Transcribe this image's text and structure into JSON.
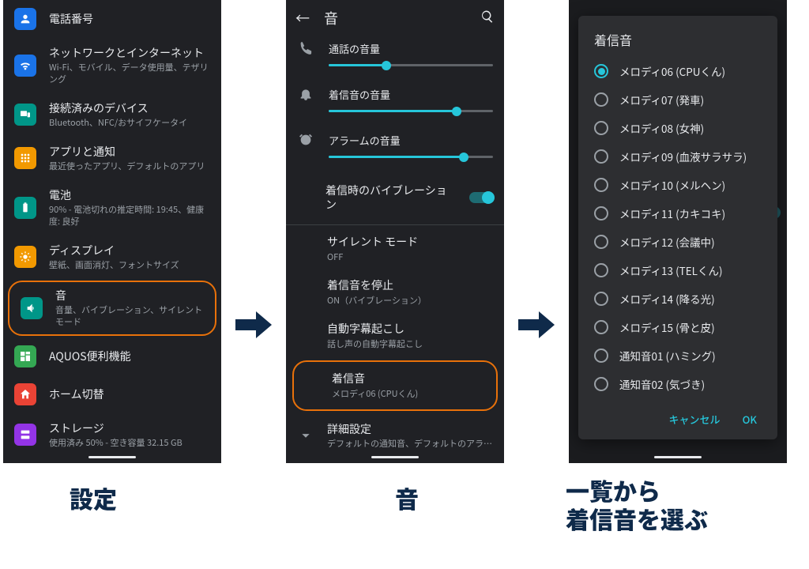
{
  "captions": {
    "settings": "設定",
    "sound": "音",
    "choose": "一覧から\n着信音を選ぶ"
  },
  "screen1": {
    "items": [
      {
        "title": "電話番号",
        "sub": ""
      },
      {
        "title": "ネットワークとインターネット",
        "sub": "Wi-Fi、モバイル、データ使用量、テザリング"
      },
      {
        "title": "接続済みのデバイス",
        "sub": "Bluetooth、NFC/おサイフケータイ"
      },
      {
        "title": "アプリと通知",
        "sub": "最近使ったアプリ、デフォルトのアプリ"
      },
      {
        "title": "電池",
        "sub": "90% - 電池切れの推定時間: 19:45、健康度: 良好"
      },
      {
        "title": "ディスプレイ",
        "sub": "壁紙、画面消灯、フォントサイズ"
      },
      {
        "title": "音",
        "sub": "音量、バイブレーション、サイレント モード"
      },
      {
        "title": "AQUOS便利機能",
        "sub": ""
      },
      {
        "title": "ホーム切替",
        "sub": ""
      },
      {
        "title": "ストレージ",
        "sub": "使用済み 50% - 空き容量 32.15 GB"
      }
    ]
  },
  "screen2": {
    "header": "音",
    "sliders": [
      {
        "label": "通話の音量",
        "pct": 35
      },
      {
        "label": "着信音の音量",
        "pct": 78
      },
      {
        "label": "アラームの音量",
        "pct": 82
      }
    ],
    "vibration": {
      "label": "着信時のバイブレーション"
    },
    "silent": {
      "title": "サイレント モード",
      "sub": "OFF"
    },
    "stop": {
      "title": "着信音を停止",
      "sub": "ON（バイブレーション）"
    },
    "caption": {
      "title": "自動字幕起こし",
      "sub": "話し声の自動字幕起こし"
    },
    "ringtone": {
      "title": "着信音",
      "sub": "メロディ06 (CPUくん)"
    },
    "advanced": {
      "title": "詳細設定",
      "sub": "デフォルトの通知音、デフォルトのアラ…"
    }
  },
  "screen3": {
    "dialog_title": "着信音",
    "options": [
      {
        "label": "メロディ06 (CPUくん)",
        "selected": true
      },
      {
        "label": "メロディ07 (発車)"
      },
      {
        "label": "メロディ08 (女神)"
      },
      {
        "label": "メロディ09 (血液サラサラ)"
      },
      {
        "label": "メロディ10 (メルヘン)"
      },
      {
        "label": "メロディ11 (カキコキ)"
      },
      {
        "label": "メロディ12 (会議中)"
      },
      {
        "label": "メロディ13 (TELくん)"
      },
      {
        "label": "メロディ14 (降る光)"
      },
      {
        "label": "メロディ15 (骨と皮)"
      },
      {
        "label": "通知音01 (ハミング)"
      },
      {
        "label": "通知音02 (気づき)"
      }
    ],
    "cancel": "キャンセル",
    "ok": "OK"
  }
}
